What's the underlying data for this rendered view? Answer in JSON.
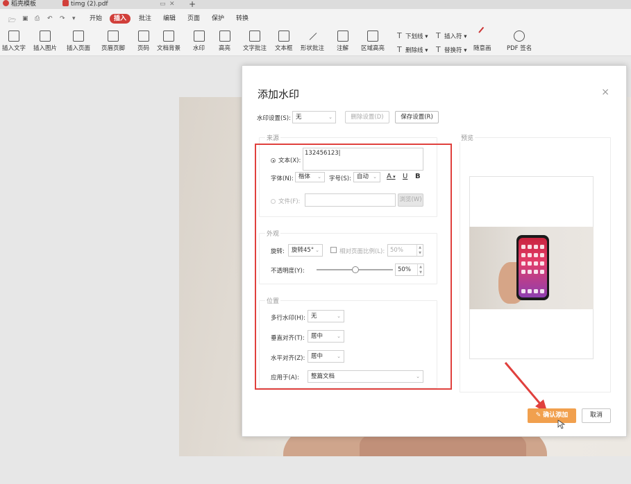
{
  "tabs": [
    {
      "label": "稻壳模板",
      "color": "#d13f3a"
    },
    {
      "label": "timg (2).pdf",
      "color": "#d13f3a"
    }
  ],
  "tab_new_symbol": "+",
  "menu": {
    "items": [
      "开始",
      "插入",
      "批注",
      "编辑",
      "页面",
      "保护",
      "转换"
    ],
    "active": "插入"
  },
  "toolbar": {
    "buttons": [
      "插入文字",
      "插入图片",
      "插入页面",
      "页眉页脚",
      "页码",
      "文档背景",
      "水印",
      "高亮",
      "文字批注",
      "文本框",
      "形状批注",
      "注解",
      "区域高亮",
      "随意画",
      "PDF 签名"
    ],
    "small": [
      "下划线",
      "删除线",
      "插入符",
      "替换符"
    ]
  },
  "dialog": {
    "title": "添加水印",
    "close_symbol": "×",
    "watermark_setting_label": "水印设置(S):",
    "watermark_setting_value": "无",
    "delete_setting": "删除设置(D)",
    "save_setting": "保存设置(R)",
    "source": {
      "title": "来源",
      "text_label": "文本(X):",
      "text_value": "132456123",
      "font_label": "字体(N):",
      "font_value": "楷体",
      "size_label": "字号(S):",
      "size_value": "自动",
      "font_color_symbol": "A",
      "underline_symbol": "U",
      "bold_symbol": "B",
      "file_label": "文件(F):",
      "browse": "浏览(W)"
    },
    "appearance": {
      "title": "外观",
      "rotate_label": "旋转:",
      "rotate_value": "旋转45°",
      "relative_scale_label": "相对页面比例(L):",
      "relative_scale_value": "50%",
      "opacity_label": "不透明度(Y):",
      "opacity_value": "50%",
      "opacity_level": 0.5
    },
    "position": {
      "title": "位置",
      "multiline_label": "多行水印(H):",
      "multiline_value": "无",
      "vertical_label": "垂直对齐(T):",
      "vertical_value": "居中",
      "horizontal_label": "水平对齐(Z):",
      "horizontal_value": "居中",
      "apply_label": "应用于(A):",
      "apply_value": "整篇文档"
    },
    "preview_title": "预览",
    "confirm": "确认添加",
    "cancel": "取消"
  },
  "colors": {
    "accent": "#d13f3a",
    "confirm": "#f1a04e",
    "highlight": "#e0403d"
  }
}
